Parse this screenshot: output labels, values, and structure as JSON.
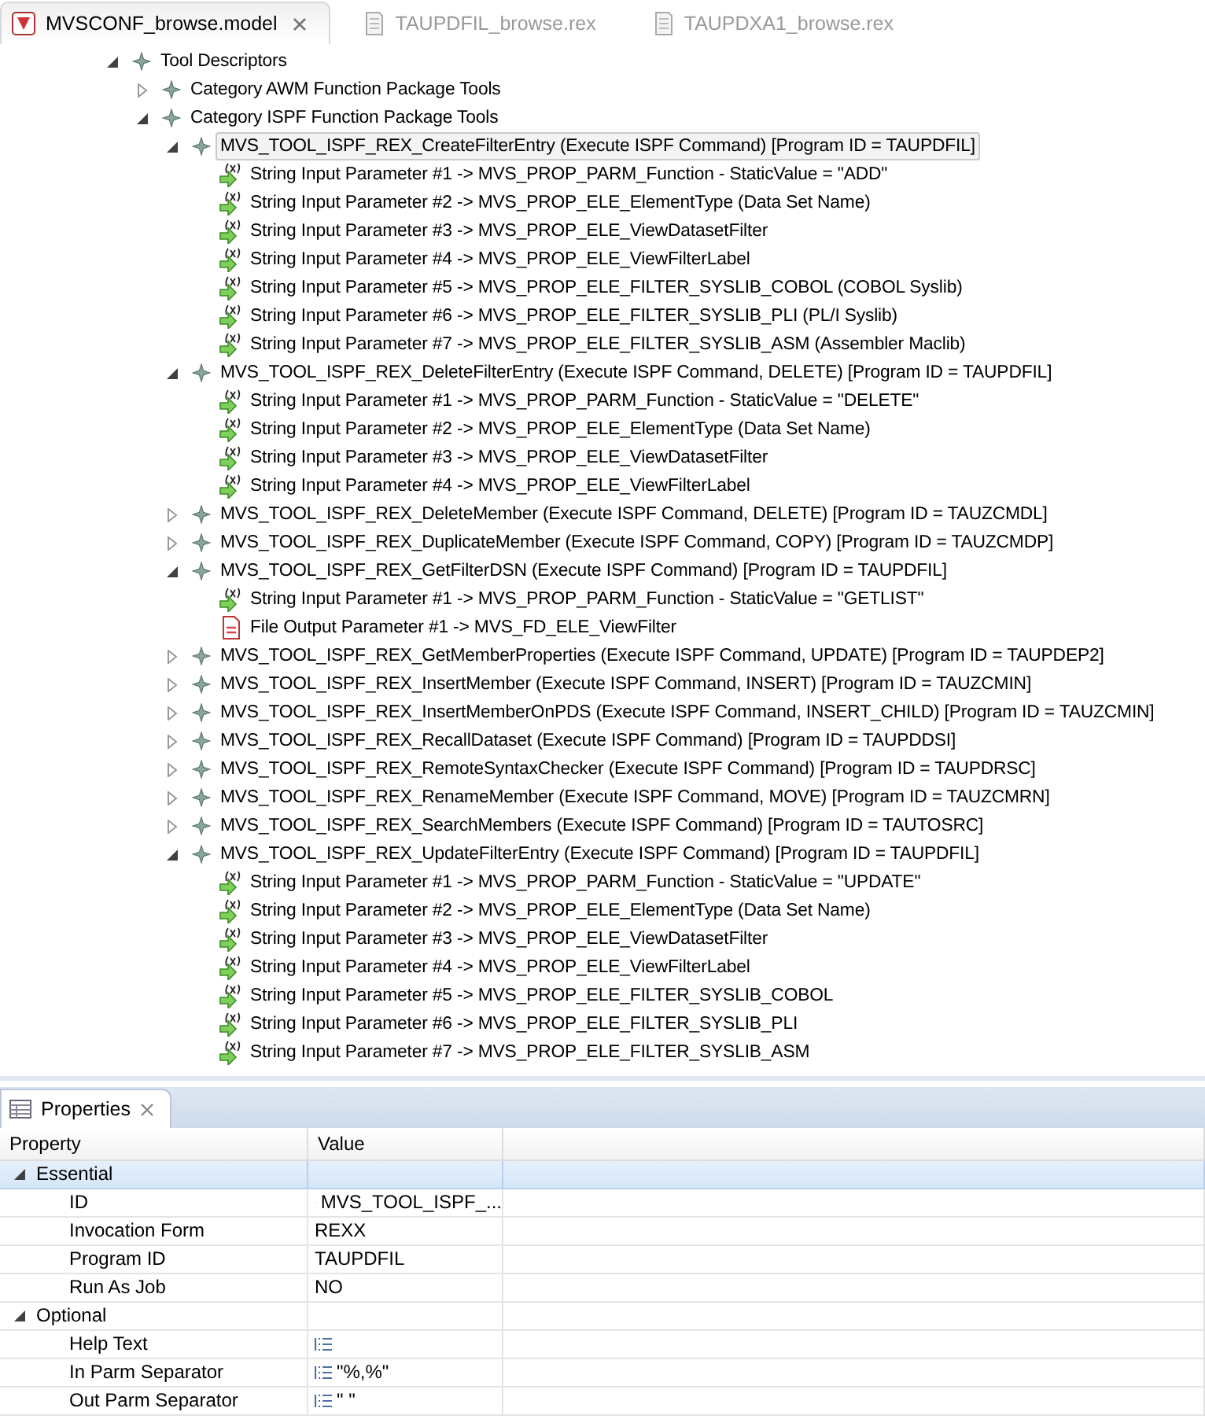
{
  "editor_tabs": [
    {
      "label": "MVSCONF_browse.model",
      "kind": "model",
      "selected": true,
      "closable": true
    },
    {
      "label": "TAUPDFIL_browse.rex",
      "kind": "rex",
      "selected": false,
      "closable": false
    },
    {
      "label": "TAUPDXA1_browse.rex",
      "kind": "rex",
      "selected": false,
      "closable": false
    }
  ],
  "tree": [
    {
      "label": "Tool Descriptors",
      "kind": "descriptor",
      "expanded": true,
      "selected": false,
      "children": [
        {
          "label": "Category AWM Function Package Tools",
          "kind": "descriptor",
          "expanded": false,
          "selected": false
        },
        {
          "label": "Category ISPF Function Package Tools",
          "kind": "descriptor",
          "expanded": true,
          "selected": false,
          "children": [
            {
              "label": "MVS_TOOL_ISPF_REX_CreateFilterEntry (Execute ISPF Command) [Program ID = TAUPDFIL]",
              "kind": "descriptor",
              "expanded": true,
              "selected": true,
              "children": [
                {
                  "label": "String Input Parameter #1 -> MVS_PROP_PARM_Function - StaticValue = \"ADD\"",
                  "kind": "string-param",
                  "selected": false
                },
                {
                  "label": "String Input Parameter #2 -> MVS_PROP_ELE_ElementType (Data Set Name)",
                  "kind": "string-param",
                  "selected": false
                },
                {
                  "label": "String Input Parameter #3 -> MVS_PROP_ELE_ViewDatasetFilter",
                  "kind": "string-param",
                  "selected": false
                },
                {
                  "label": "String Input Parameter #4 -> MVS_PROP_ELE_ViewFilterLabel",
                  "kind": "string-param",
                  "selected": false
                },
                {
                  "label": "String Input Parameter #5 -> MVS_PROP_ELE_FILTER_SYSLIB_COBOL (COBOL Syslib)",
                  "kind": "string-param",
                  "selected": false
                },
                {
                  "label": "String Input Parameter #6 -> MVS_PROP_ELE_FILTER_SYSLIB_PLI (PL/I Syslib)",
                  "kind": "string-param",
                  "selected": false
                },
                {
                  "label": "String Input Parameter #7 -> MVS_PROP_ELE_FILTER_SYSLIB_ASM (Assembler Maclib)",
                  "kind": "string-param",
                  "selected": false
                }
              ]
            },
            {
              "label": "MVS_TOOL_ISPF_REX_DeleteFilterEntry (Execute ISPF Command, DELETE) [Program ID = TAUPDFIL]",
              "kind": "descriptor",
              "expanded": true,
              "selected": false,
              "children": [
                {
                  "label": "String Input Parameter #1 -> MVS_PROP_PARM_Function - StaticValue = \"DELETE\"",
                  "kind": "string-param",
                  "selected": false
                },
                {
                  "label": "String Input Parameter #2 -> MVS_PROP_ELE_ElementType (Data Set Name)",
                  "kind": "string-param",
                  "selected": false
                },
                {
                  "label": "String Input Parameter #3 -> MVS_PROP_ELE_ViewDatasetFilter",
                  "kind": "string-param",
                  "selected": false
                },
                {
                  "label": "String Input Parameter #4 -> MVS_PROP_ELE_ViewFilterLabel",
                  "kind": "string-param",
                  "selected": false
                }
              ]
            },
            {
              "label": "MVS_TOOL_ISPF_REX_DeleteMember (Execute ISPF Command, DELETE) [Program ID = TAUZCMDL]",
              "kind": "descriptor",
              "expanded": false,
              "selected": false
            },
            {
              "label": "MVS_TOOL_ISPF_REX_DuplicateMember (Execute ISPF Command, COPY) [Program ID = TAUZCMDP]",
              "kind": "descriptor",
              "expanded": false,
              "selected": false
            },
            {
              "label": "MVS_TOOL_ISPF_REX_GetFilterDSN (Execute ISPF Command) [Program ID = TAUPDFIL]",
              "kind": "descriptor",
              "expanded": true,
              "selected": false,
              "children": [
                {
                  "label": "String Input Parameter #1 -> MVS_PROP_PARM_Function - StaticValue = \"GETLIST\"",
                  "kind": "string-param",
                  "selected": false
                },
                {
                  "label": "File Output Parameter #1 -> MVS_FD_ELE_ViewFilter",
                  "kind": "file-output",
                  "selected": false
                }
              ]
            },
            {
              "label": "MVS_TOOL_ISPF_REX_GetMemberProperties (Execute ISPF Command, UPDATE) [Program ID = TAUPDEP2]",
              "kind": "descriptor",
              "expanded": false,
              "selected": false
            },
            {
              "label": "MVS_TOOL_ISPF_REX_InsertMember (Execute ISPF Command, INSERT) [Program ID = TAUZCMIN]",
              "kind": "descriptor",
              "expanded": false,
              "selected": false
            },
            {
              "label": "MVS_TOOL_ISPF_REX_InsertMemberOnPDS (Execute ISPF Command, INSERT_CHILD) [Program ID = TAUZCMIN]",
              "kind": "descriptor",
              "expanded": false,
              "selected": false
            },
            {
              "label": "MVS_TOOL_ISPF_REX_RecallDataset (Execute ISPF Command) [Program ID = TAUPDDSI]",
              "kind": "descriptor",
              "expanded": false,
              "selected": false
            },
            {
              "label": "MVS_TOOL_ISPF_REX_RemoteSyntaxChecker (Execute ISPF Command) [Program ID = TAUPDRSC]",
              "kind": "descriptor",
              "expanded": false,
              "selected": false
            },
            {
              "label": "MVS_TOOL_ISPF_REX_RenameMember (Execute ISPF Command, MOVE) [Program ID = TAUZCMRN]",
              "kind": "descriptor",
              "expanded": false,
              "selected": false
            },
            {
              "label": "MVS_TOOL_ISPF_REX_SearchMembers (Execute ISPF Command) [Program ID = TAUTOSRC]",
              "kind": "descriptor",
              "expanded": false,
              "selected": false
            },
            {
              "label": "MVS_TOOL_ISPF_REX_UpdateFilterEntry (Execute ISPF Command) [Program ID = TAUPDFIL]",
              "kind": "descriptor",
              "expanded": true,
              "selected": false,
              "children": [
                {
                  "label": "String Input Parameter #1 -> MVS_PROP_PARM_Function - StaticValue = \"UPDATE\"",
                  "kind": "string-param",
                  "selected": false
                },
                {
                  "label": "String Input Parameter #2 -> MVS_PROP_ELE_ElementType (Data Set Name)",
                  "kind": "string-param",
                  "selected": false
                },
                {
                  "label": "String Input Parameter #3 -> MVS_PROP_ELE_ViewDatasetFilter",
                  "kind": "string-param",
                  "selected": false
                },
                {
                  "label": "String Input Parameter #4 -> MVS_PROP_ELE_ViewFilterLabel",
                  "kind": "string-param",
                  "selected": false
                },
                {
                  "label": "String Input Parameter #5 -> MVS_PROP_ELE_FILTER_SYSLIB_COBOL",
                  "kind": "string-param",
                  "selected": false
                },
                {
                  "label": "String Input Parameter #6 -> MVS_PROP_ELE_FILTER_SYSLIB_PLI",
                  "kind": "string-param",
                  "selected": false
                },
                {
                  "label": "String Input Parameter #7 -> MVS_PROP_ELE_FILTER_SYSLIB_ASM",
                  "kind": "string-param",
                  "selected": false
                }
              ]
            }
          ]
        }
      ]
    }
  ],
  "properties": {
    "title": "Properties",
    "columns": [
      "Property",
      "Value"
    ],
    "groups": [
      {
        "label": "Essential",
        "expanded": true,
        "selected": true,
        "rows": [
          {
            "name": "ID",
            "value": "MVS_TOOL_ISPF_...",
            "kind": "editable"
          },
          {
            "name": "Invocation Form",
            "value": "REXX",
            "kind": "plain"
          },
          {
            "name": "Program ID",
            "value": "TAUPDFIL",
            "kind": "plain"
          },
          {
            "name": "Run As Job",
            "value": "NO",
            "kind": "plain"
          }
        ]
      },
      {
        "label": "Optional",
        "expanded": true,
        "selected": false,
        "rows": [
          {
            "name": "Help Text",
            "kind": "editable"
          },
          {
            "name": "In Parm Separator",
            "value": "\"%,%\"",
            "kind": "editable"
          },
          {
            "name": "Out Parm Separator",
            "value": "\" \"",
            "kind": "editable"
          }
        ]
      }
    ]
  }
}
